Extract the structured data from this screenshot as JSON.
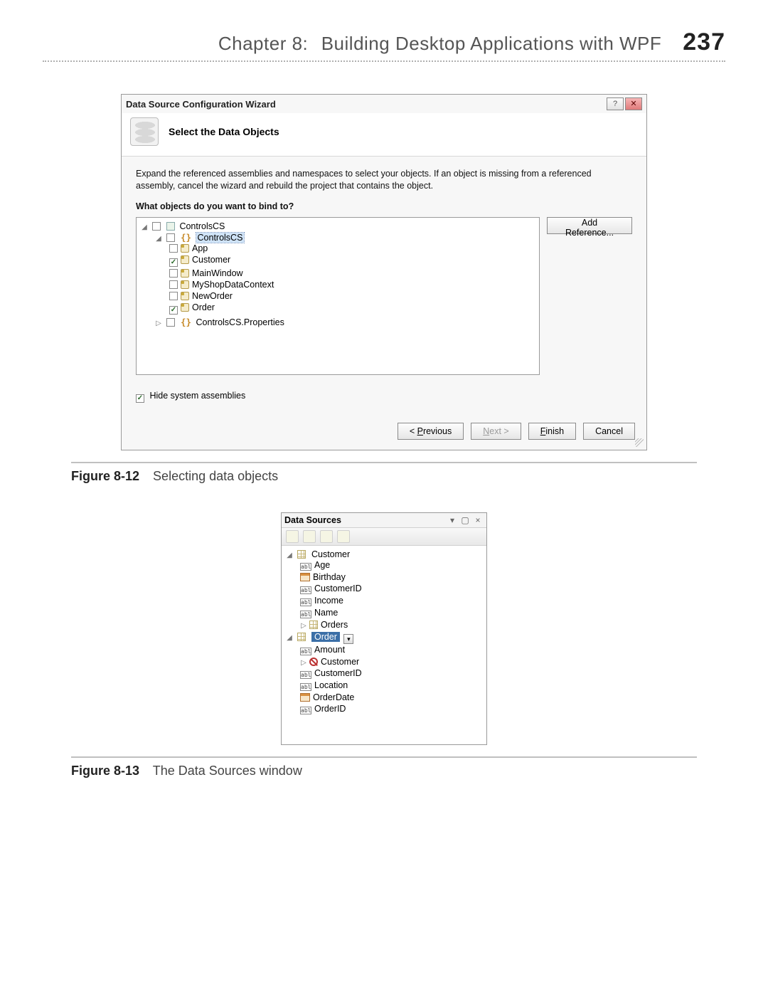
{
  "page": {
    "chapter_label": "Chapter 8:",
    "chapter_title": "Building Desktop Applications with WPF",
    "page_number": "237"
  },
  "dialog": {
    "title": "Data Source Configuration Wizard",
    "help_glyph": "?",
    "close_glyph": "✕",
    "heading": "Select the Data Objects",
    "instruction": "Expand the referenced assemblies and namespaces to select your objects. If an object is missing from a referenced assembly, cancel the wizard and rebuild the project that contains the object.",
    "prompt": "What objects do you want to bind to?",
    "tree": {
      "root": "ControlsCS",
      "ns": "ControlsCS",
      "items": [
        {
          "name": "App",
          "checked": false
        },
        {
          "name": "Customer",
          "checked": true
        },
        {
          "name": "MainWindow",
          "checked": false
        },
        {
          "name": "MyShopDataContext",
          "checked": false
        },
        {
          "name": "NewOrder",
          "checked": false
        },
        {
          "name": "Order",
          "checked": true
        }
      ],
      "props_ns": "ControlsCS.Properties"
    },
    "add_ref_label": "Add Reference...",
    "hide_label": "Hide system assemblies",
    "hide_checked": true,
    "buttons": {
      "previous_pre": "< ",
      "previous_u": "P",
      "previous_post": "revious",
      "next_u": "N",
      "next_post": "ext >",
      "finish_u": "F",
      "finish_post": "inish",
      "cancel": "Cancel"
    }
  },
  "figure1": {
    "number": "Figure 8-12",
    "caption": "Selecting data objects"
  },
  "panel": {
    "title": "Data Sources",
    "menu_glyph": "▾",
    "pin_glyph": "▢",
    "close_glyph": "×",
    "customer": {
      "name": "Customer",
      "fields": [
        "Age",
        "Birthday",
        "CustomerID",
        "Income",
        "Name",
        "Orders"
      ]
    },
    "order": {
      "name": "Order",
      "fields": [
        "Amount",
        "Customer",
        "CustomerID",
        "Location",
        "OrderDate",
        "OrderID"
      ]
    }
  },
  "figure2": {
    "number": "Figure 8-13",
    "caption": "The Data Sources window"
  }
}
